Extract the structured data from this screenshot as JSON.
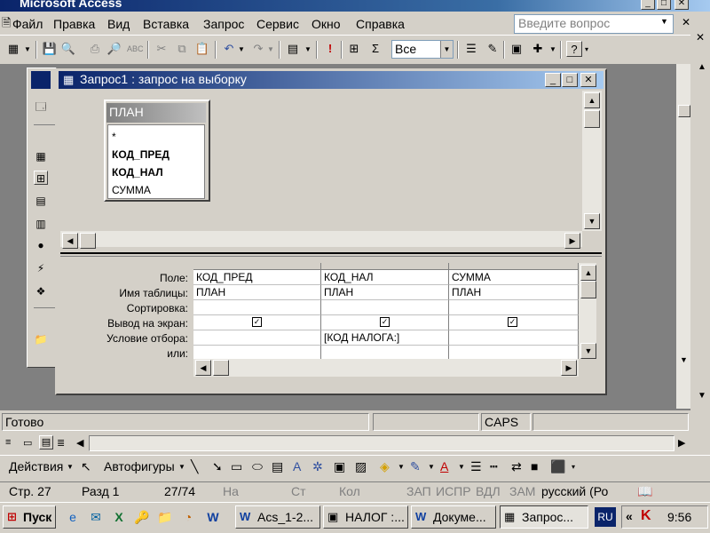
{
  "app": {
    "title": "Microsoft Access"
  },
  "menu": {
    "items": [
      "Файл",
      "Правка",
      "Вид",
      "Вставка",
      "Запрос",
      "Сервис",
      "Окно",
      "Справка"
    ],
    "ask_placeholder": "Введите вопрос"
  },
  "toolbar": {
    "query_type_value": "Все"
  },
  "query_window": {
    "title": "Запрос1 : запрос на выборку",
    "table": {
      "name": "ПЛАН",
      "fields": [
        "*",
        "КОД_ПРЕД",
        "КОД_НАЛ",
        "СУММА"
      ],
      "bold_fields": [
        "КОД_ПРЕД",
        "КОД_НАЛ"
      ]
    },
    "grid": {
      "row_labels": [
        "Поле:",
        "Имя таблицы:",
        "Сортировка:",
        "Вывод на экран:",
        "Условие отбора:",
        "или:"
      ],
      "columns": [
        {
          "field": "КОД_ПРЕД",
          "table": "ПЛАН",
          "sort": "",
          "show": true,
          "criteria": "",
          "or": ""
        },
        {
          "field": "КОД_НАЛ",
          "table": "ПЛАН",
          "sort": "",
          "show": true,
          "criteria": "[КОД НАЛОГА:]",
          "or": ""
        },
        {
          "field": "СУММА",
          "table": "ПЛАН",
          "sort": "",
          "show": true,
          "criteria": "",
          "or": ""
        }
      ]
    }
  },
  "status_bar": {
    "text": "Готово",
    "caps": "CAPS"
  },
  "drawing_toolbar": {
    "actions_label": "Действия",
    "autoshapes_label": "Автофигуры"
  },
  "word_status": {
    "page": "Стр. 27",
    "section": "Разд 1",
    "pages": "27/74",
    "at": "На",
    "line": "Ст",
    "col": "Кол",
    "rec": "ЗАП",
    "trk": "ИСПР",
    "ext": "ВДЛ",
    "ovr": "ЗАМ",
    "language": "русский (Ро"
  },
  "taskbar": {
    "start_label": "Пуск",
    "tasks": [
      {
        "label": "Acs_1-2...",
        "active": false
      },
      {
        "label": "НАЛОГ :...",
        "active": false
      },
      {
        "label": "Докуме...",
        "active": false
      },
      {
        "label": "Запрос...",
        "active": true
      }
    ],
    "lang": "RU",
    "clock": "9:56"
  }
}
